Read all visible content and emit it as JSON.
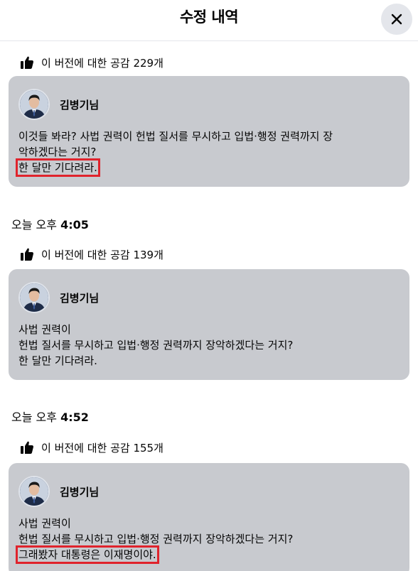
{
  "header": {
    "title": "수정 내역",
    "close_label": "✕"
  },
  "versions": [
    {
      "likes": "이 버전에 대한 공감 229개",
      "author": "김병기님",
      "lines": [
        "이것들 봐라? 사법 권력이 헌법 질서를 무시하고 입법·행정 권력까지 장",
        "악하겠다는 거지?",
        "한 달만 기다려라."
      ]
    },
    {
      "date_prefix": "오늘 오후",
      "date_time": "4:05",
      "likes": "이 버전에 대한 공감 139개",
      "author": "김병기님",
      "lines": [
        "사법 권력이",
        "헌법 질서를 무시하고 입법·행정 권력까지 장악하겠다는 거지?",
        "한 달만 기다려라."
      ]
    },
    {
      "date_prefix": "오늘 오후",
      "date_time": "4:52",
      "likes": "이 버전에 대한 공감 155개",
      "author": "김병기님",
      "lines": [
        "사법 권력이",
        "헌법 질서를 무시하고 입법·행정 권력까지 장악하겠다는 거지?",
        "그래봤자 대통령은 이재명이야."
      ]
    }
  ]
}
